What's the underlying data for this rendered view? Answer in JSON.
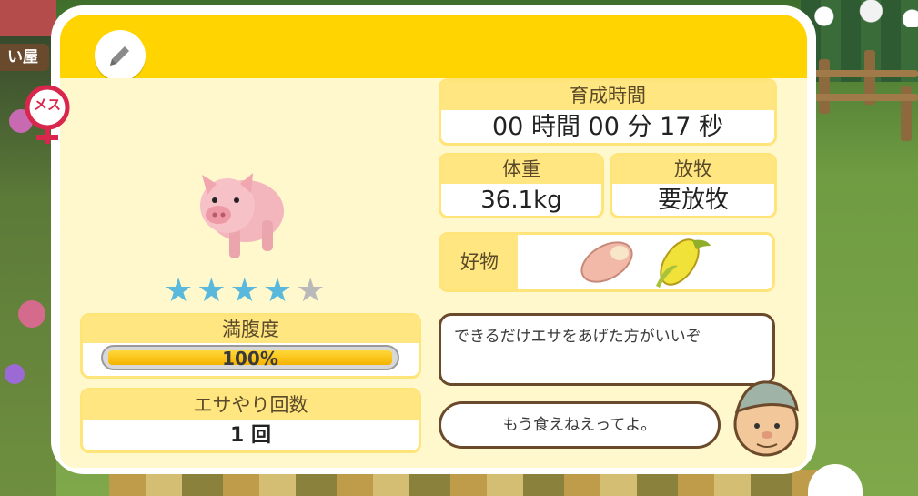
{
  "background": {
    "sign_text": "い屋"
  },
  "header": {
    "edit_icon": "pencil-icon"
  },
  "pet": {
    "gender_label": "メス",
    "gender_icon": "female-symbol-icon",
    "animal_icon": "pig-icon",
    "rating": 4,
    "rating_max": 5
  },
  "fullness": {
    "label": "満腹度",
    "value_text": "100%",
    "percent": 100
  },
  "feed_count": {
    "label": "エサやり回数",
    "value": "1 回"
  },
  "growth_time": {
    "label": "育成時間",
    "value": "00 時間 00 分 17 秒"
  },
  "weight": {
    "label": "体重",
    "value": "36.1kg"
  },
  "grazing": {
    "label": "放牧",
    "value": "要放牧"
  },
  "favorites": {
    "label": "好物",
    "items": [
      "sweet-potato-icon",
      "corn-icon"
    ]
  },
  "speech": {
    "advice": "できるだけエサをあげた方がいいぞ",
    "reply": "もう食えねえってよ。",
    "speaker_icon": "farmer-avatar-icon"
  },
  "colors": {
    "header": "#ffd400",
    "body": "#fff8cc",
    "star_on": "#5ab8dc",
    "star_off": "#b9b9b9",
    "bar": "#f5b300"
  }
}
